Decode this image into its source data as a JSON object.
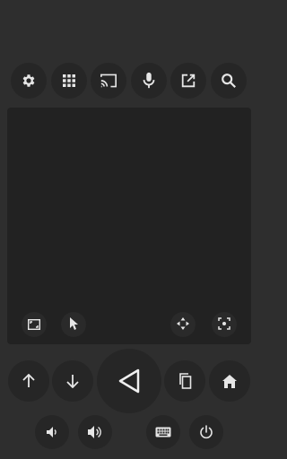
{
  "toolbar": {
    "items": [
      {
        "name": "settings",
        "icon": "gear-icon"
      },
      {
        "name": "apps",
        "icon": "grid-icon"
      },
      {
        "name": "cast",
        "icon": "cast-icon"
      },
      {
        "name": "voice",
        "icon": "microphone-icon"
      },
      {
        "name": "open",
        "icon": "open-external-icon"
      },
      {
        "name": "search",
        "icon": "search-icon"
      }
    ]
  },
  "touchpad": {
    "tools": [
      {
        "name": "fullscreen",
        "icon": "fullscreen-icon"
      },
      {
        "name": "pointer",
        "icon": "cursor-icon"
      },
      {
        "name": "dpad",
        "icon": "dpad-icon"
      },
      {
        "name": "capture",
        "icon": "capture-icon"
      }
    ]
  },
  "controls": {
    "up": {
      "icon": "arrow-up-icon"
    },
    "down": {
      "icon": "arrow-down-icon"
    },
    "back": {
      "icon": "back-triangle-icon"
    },
    "copy": {
      "icon": "copy-icon"
    },
    "home": {
      "icon": "home-icon"
    }
  },
  "bottom": {
    "volume_down": {
      "icon": "volume-down-icon"
    },
    "volume_up": {
      "icon": "volume-up-icon"
    },
    "keyboard": {
      "icon": "keyboard-icon"
    },
    "power": {
      "icon": "power-icon"
    }
  },
  "colors": {
    "background": "#2e2e2e",
    "button": "#262626",
    "touchpad": "#222222",
    "icon": "#e6e6e6"
  }
}
